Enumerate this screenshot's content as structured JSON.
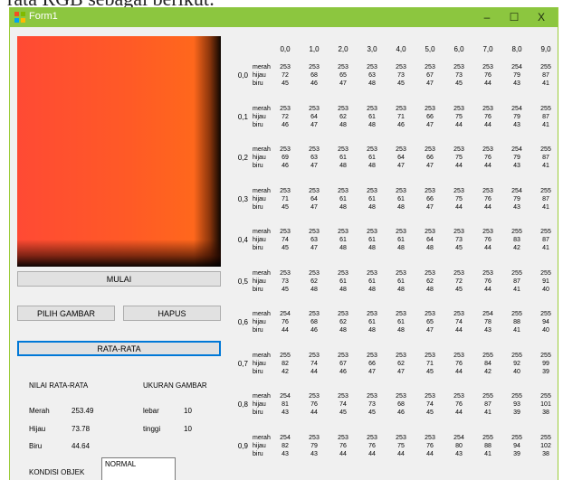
{
  "page_top_text": "rata RGB sebagai berikut:",
  "window": {
    "title": "Form1",
    "minimize": "–",
    "maximize": "☐",
    "close": "X",
    "accent": "#8cc63f"
  },
  "buttons": {
    "mulai": "MULAI",
    "pilih_gambar": "PILIH GAMBAR",
    "hapus": "HAPUS",
    "rata_rata": "RATA-RATA"
  },
  "results": {
    "nilai_label": "NILAI RATA-RATA",
    "ukuran_label": "UKURAN GAMBAR",
    "merah_label": "Merah",
    "merah_value": "253.49",
    "hijau_label": "Hijau",
    "hijau_value": "73.78",
    "biru_label": "Biru",
    "biru_value": "44.64",
    "lebar_label": "lebar",
    "lebar_value": "10",
    "tinggi_label": "tinggi",
    "tinggi_value": "10",
    "kondisi_label": "KONDISI OBJEK",
    "kondisi_value": "NORMAL"
  },
  "grid": {
    "columns": [
      "0,0",
      "1,0",
      "2,0",
      "3,0",
      "4,0",
      "5,0",
      "6,0",
      "7,0",
      "8,0",
      "9,0"
    ],
    "channels": [
      "merah",
      "hijau",
      "biru"
    ],
    "rows": [
      {
        "label": "0,0",
        "cells": [
          [
            253,
            72,
            45
          ],
          [
            253,
            68,
            46
          ],
          [
            253,
            65,
            47
          ],
          [
            253,
            63,
            48
          ],
          [
            253,
            73,
            45
          ],
          [
            253,
            67,
            47
          ],
          [
            253,
            73,
            45
          ],
          [
            253,
            76,
            44
          ],
          [
            254,
            79,
            43
          ],
          [
            255,
            87,
            41
          ]
        ]
      },
      {
        "label": "0,1",
        "cells": [
          [
            253,
            72,
            46
          ],
          [
            253,
            64,
            47
          ],
          [
            253,
            62,
            48
          ],
          [
            253,
            61,
            48
          ],
          [
            253,
            71,
            46
          ],
          [
            253,
            66,
            47
          ],
          [
            253,
            75,
            44
          ],
          [
            253,
            76,
            44
          ],
          [
            254,
            79,
            43
          ],
          [
            255,
            87,
            41
          ]
        ]
      },
      {
        "label": "0,2",
        "cells": [
          [
            253,
            69,
            46
          ],
          [
            253,
            63,
            47
          ],
          [
            253,
            61,
            48
          ],
          [
            253,
            61,
            48
          ],
          [
            253,
            64,
            47
          ],
          [
            253,
            66,
            47
          ],
          [
            253,
            75,
            44
          ],
          [
            253,
            76,
            44
          ],
          [
            254,
            79,
            43
          ],
          [
            255,
            87,
            41
          ]
        ]
      },
      {
        "label": "0,3",
        "cells": [
          [
            253,
            71,
            45
          ],
          [
            253,
            64,
            47
          ],
          [
            253,
            61,
            48
          ],
          [
            253,
            61,
            48
          ],
          [
            253,
            61,
            48
          ],
          [
            253,
            66,
            47
          ],
          [
            253,
            75,
            44
          ],
          [
            253,
            76,
            44
          ],
          [
            254,
            79,
            43
          ],
          [
            255,
            87,
            41
          ]
        ]
      },
      {
        "label": "0,4",
        "cells": [
          [
            253,
            74,
            45
          ],
          [
            253,
            63,
            47
          ],
          [
            253,
            61,
            48
          ],
          [
            253,
            61,
            48
          ],
          [
            253,
            61,
            48
          ],
          [
            253,
            64,
            48
          ],
          [
            253,
            73,
            45
          ],
          [
            253,
            76,
            44
          ],
          [
            255,
            83,
            42
          ],
          [
            255,
            87,
            41
          ]
        ]
      },
      {
        "label": "0,5",
        "cells": [
          [
            253,
            73,
            45
          ],
          [
            253,
            62,
            48
          ],
          [
            253,
            61,
            48
          ],
          [
            253,
            61,
            48
          ],
          [
            253,
            61,
            48
          ],
          [
            253,
            62,
            48
          ],
          [
            253,
            72,
            45
          ],
          [
            253,
            76,
            44
          ],
          [
            255,
            87,
            41
          ],
          [
            255,
            91,
            40
          ]
        ]
      },
      {
        "label": "0,6",
        "cells": [
          [
            254,
            76,
            44
          ],
          [
            253,
            68,
            46
          ],
          [
            253,
            62,
            48
          ],
          [
            253,
            61,
            48
          ],
          [
            253,
            61,
            48
          ],
          [
            253,
            65,
            47
          ],
          [
            253,
            74,
            44
          ],
          [
            254,
            78,
            43
          ],
          [
            255,
            88,
            41
          ],
          [
            255,
            94,
            40
          ]
        ]
      },
      {
        "label": "0,7",
        "cells": [
          [
            255,
            82,
            42
          ],
          [
            253,
            74,
            44
          ],
          [
            253,
            67,
            46
          ],
          [
            253,
            66,
            47
          ],
          [
            253,
            62,
            47
          ],
          [
            253,
            71,
            45
          ],
          [
            253,
            76,
            44
          ],
          [
            255,
            84,
            42
          ],
          [
            255,
            92,
            40
          ],
          [
            255,
            99,
            39
          ]
        ]
      },
      {
        "label": "0,8",
        "cells": [
          [
            254,
            81,
            43
          ],
          [
            253,
            76,
            44
          ],
          [
            253,
            74,
            45
          ],
          [
            253,
            73,
            45
          ],
          [
            253,
            68,
            46
          ],
          [
            253,
            74,
            45
          ],
          [
            253,
            76,
            44
          ],
          [
            255,
            87,
            41
          ],
          [
            255,
            93,
            39
          ],
          [
            255,
            101,
            38
          ]
        ]
      },
      {
        "label": "0,9",
        "cells": [
          [
            254,
            82,
            43
          ],
          [
            253,
            79,
            43
          ],
          [
            253,
            76,
            44
          ],
          [
            253,
            76,
            44
          ],
          [
            253,
            75,
            44
          ],
          [
            253,
            76,
            44
          ],
          [
            254,
            80,
            43
          ],
          [
            255,
            88,
            41
          ],
          [
            255,
            94,
            39
          ],
          [
            255,
            102,
            38
          ]
        ]
      }
    ]
  }
}
